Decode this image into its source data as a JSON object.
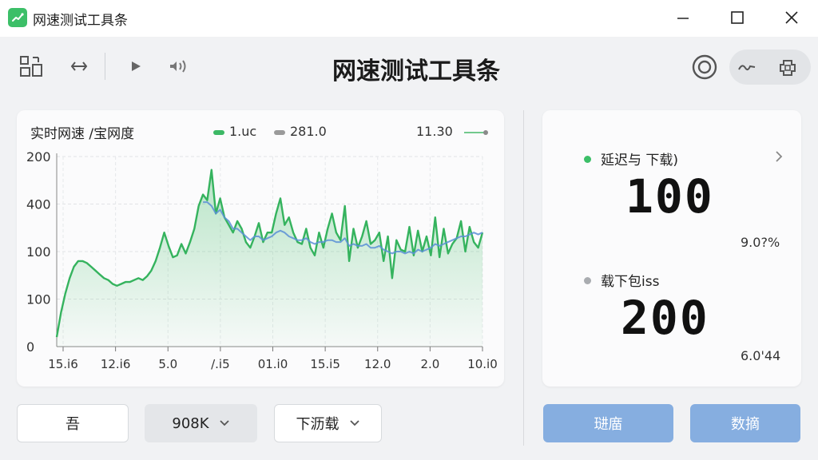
{
  "window": {
    "title": "网速测试工具条",
    "controls": {
      "minimize_icon": "minimize-icon",
      "maximize_icon": "maximize-icon",
      "close_icon": "close-icon"
    }
  },
  "toolbar": {
    "title": "网速测试工具条",
    "left_icons": [
      "layout-icon",
      "swap-arrows-icon",
      "play-icon",
      "volume-icon"
    ],
    "right_icons": [
      "target-icon",
      "wave-icon",
      "plugin-icon"
    ]
  },
  "chart_panel": {
    "title": "实时网速 /宝网度",
    "legend": [
      {
        "label": "1.uc",
        "color": "#3cb865"
      },
      {
        "label": "281.0",
        "color": "#9a9a9a"
      },
      {
        "label": "11.30",
        "color": "#72c98d"
      }
    ]
  },
  "chart_data": {
    "type": "line",
    "y_tick_labels": [
      "200",
      "400",
      "100",
      "100",
      "0"
    ],
    "x_tick_labels": [
      "15.i6",
      "12.i6",
      "5.0",
      "/.i5",
      "01.i0",
      "15.i5",
      "12.0",
      "2.0",
      "10.i0"
    ],
    "series": [
      {
        "color": "#35b35e",
        "values": [
          0.05,
          0.18,
          0.28,
          0.36,
          0.42,
          0.45,
          0.45,
          0.44,
          0.42,
          0.4,
          0.38,
          0.36,
          0.35,
          0.33,
          0.32,
          0.33,
          0.34,
          0.34,
          0.35,
          0.36,
          0.35,
          0.37,
          0.4,
          0.45,
          0.52,
          0.6,
          0.53,
          0.47,
          0.48,
          0.54,
          0.49,
          0.55,
          0.62,
          0.74,
          0.8,
          0.77,
          0.93,
          0.7,
          0.78,
          0.68,
          0.64,
          0.6,
          0.66,
          0.62,
          0.55,
          0.52,
          0.58,
          0.65,
          0.55,
          0.6,
          0.6,
          0.7,
          0.78,
          0.64,
          0.68,
          0.6,
          0.55,
          0.54,
          0.62,
          0.52,
          0.48,
          0.6,
          0.52,
          0.62,
          0.7,
          0.6,
          0.56,
          0.74,
          0.45,
          0.62,
          0.52,
          0.58,
          0.66,
          0.54,
          0.56,
          0.6,
          0.45,
          0.58,
          0.36,
          0.56,
          0.51,
          0.5,
          0.63,
          0.48,
          0.61,
          0.5,
          0.58,
          0.48,
          0.68,
          0.47,
          0.62,
          0.49,
          0.54,
          0.57,
          0.66,
          0.5,
          0.63,
          0.55,
          0.52,
          0.6
        ]
      },
      {
        "color": "#5b8fd6",
        "values": [
          null,
          null,
          null,
          null,
          null,
          null,
          null,
          null,
          null,
          null,
          null,
          null,
          null,
          null,
          null,
          null,
          null,
          null,
          null,
          null,
          null,
          null,
          null,
          null,
          null,
          null,
          null,
          null,
          null,
          null,
          null,
          null,
          null,
          null,
          0.76,
          0.76,
          0.74,
          0.7,
          0.72,
          0.68,
          0.66,
          0.62,
          0.62,
          0.6,
          0.58,
          0.56,
          0.58,
          0.58,
          0.56,
          0.57,
          0.58,
          0.6,
          0.61,
          0.6,
          0.58,
          0.57,
          0.56,
          0.56,
          0.57,
          0.55,
          0.54,
          0.55,
          0.55,
          0.56,
          0.56,
          0.55,
          0.55,
          0.57,
          0.53,
          0.54,
          0.53,
          0.53,
          0.54,
          0.52,
          0.52,
          0.53,
          0.51,
          0.5,
          0.49,
          0.5,
          0.5,
          0.49,
          0.5,
          0.49,
          0.51,
          0.5,
          0.51,
          0.52,
          0.54,
          0.53,
          0.54,
          0.55,
          0.56,
          0.57,
          0.58,
          0.58,
          0.59,
          0.6,
          0.59,
          0.6
        ]
      }
    ]
  },
  "stats": {
    "latency": {
      "label": "延迟与  下载)",
      "value": "100",
      "sub": "9.0?%",
      "dot_color": "#3cbf68"
    },
    "download": {
      "label": "载下包iss",
      "value": "200",
      "sub": "6.0'44",
      "dot_color": "#a9acb0"
    }
  },
  "bottom": {
    "btn_left": "吾",
    "select_1": "908K",
    "select_2": "下沥载",
    "btn_action_1": "琎庿",
    "btn_action_2": "数摘"
  }
}
